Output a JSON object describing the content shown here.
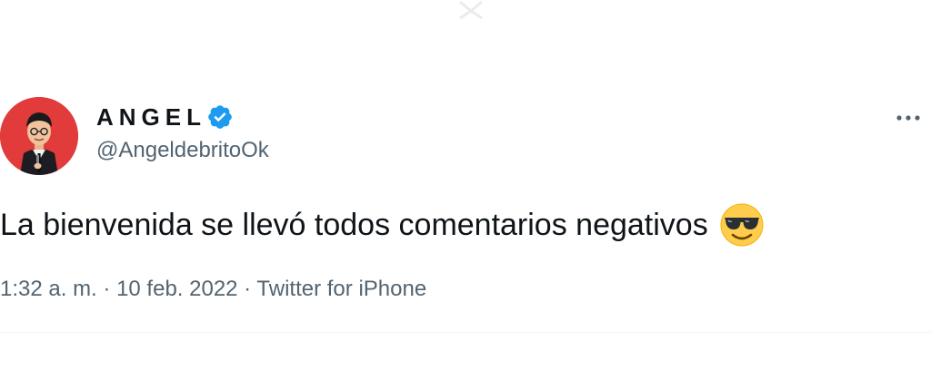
{
  "author": {
    "display_name": "ANGEL",
    "handle": "@AngeldebritoOk",
    "verified_icon": "verified-badge-icon",
    "avatar": "caricature-avatar"
  },
  "tweet": {
    "text": "La bienvenida se llevó todos comentarios negativos",
    "emoji": "smiling-face-with-sunglasses",
    "time": "1:32 a. m.",
    "separator_1": " · ",
    "date": "10 feb. 2022",
    "separator_2": " · ",
    "source": "Twitter for iPhone"
  },
  "menu": {
    "more_icon": "more-dots-icon"
  },
  "colors": {
    "text_primary": "#0f1419",
    "text_secondary": "#536471",
    "verified_blue": "#1d9bf0",
    "avatar_bg": "#e23b3b",
    "divider": "#eff3f4"
  }
}
